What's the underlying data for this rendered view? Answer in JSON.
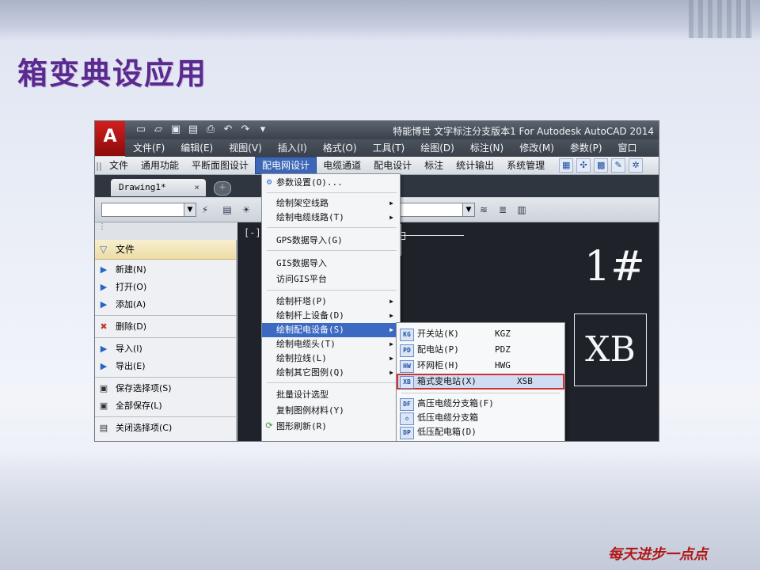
{
  "slide": {
    "title": "箱变典设应用",
    "brand_text": "每天进步一点点"
  },
  "cad": {
    "window_title": "特能博世 文字标注分支版本1 For Autodesk AutoCAD 2014",
    "menubar": [
      "文件(F)",
      "编辑(E)",
      "视图(V)",
      "插入(I)",
      "格式(O)",
      "工具(T)",
      "绘图(D)",
      "标注(N)",
      "修改(M)",
      "参数(P)",
      "窗口"
    ],
    "plugin_menubar": [
      "文件",
      "通用功能",
      "平断面图设计",
      "配电网设计",
      "电缆通道",
      "配电设计",
      "标注",
      "统计输出",
      "系统管理"
    ],
    "plugin_active_index": 3,
    "tab": {
      "label": "Drawing1*",
      "close": "×"
    },
    "left_panel": {
      "header": "文件",
      "items": [
        {
          "label": "新建(N)",
          "icon": "triangle-right-icon"
        },
        {
          "label": "打开(O)",
          "icon": "triangle-right-icon"
        },
        {
          "label": "添加(A)",
          "icon": "triangle-right-icon"
        },
        {
          "label": "删除(D)",
          "icon": "delete-icon"
        },
        {
          "label": "导入(I)",
          "icon": "triangle-right-icon"
        },
        {
          "label": "导出(E)",
          "icon": "triangle-right-icon"
        },
        {
          "label": "保存选择项(S)",
          "icon": "save-icon"
        },
        {
          "label": "全部保存(L)",
          "icon": "save-icon"
        },
        {
          "label": "关闭选择项(C)",
          "icon": "close-doc-icon"
        }
      ]
    },
    "drawing": {
      "viewport_label": "[-][",
      "number_label": "1#",
      "xb_label": "XB"
    },
    "dropdown": {
      "items": [
        {
          "label": "参数设置(O)...",
          "arrow": ""
        },
        {
          "label": "绘制架空线路",
          "arrow": "▶"
        },
        {
          "label": "绘制电缆线路(T)",
          "arrow": "▶"
        },
        {
          "label": "GPS数据导入(G)",
          "arrow": ""
        },
        {
          "label": "GIS数据导入",
          "arrow": ""
        },
        {
          "label": "访问GIS平台",
          "arrow": ""
        },
        {
          "label": "绘制杆塔(P)",
          "arrow": "▶"
        },
        {
          "label": "绘制杆上设备(D)",
          "arrow": "▶"
        },
        {
          "label": "绘制配电设备(S)",
          "arrow": "▶"
        },
        {
          "label": "绘制电缆头(T)",
          "arrow": "▶"
        },
        {
          "label": "绘制拉线(L)",
          "arrow": "▶"
        },
        {
          "label": "绘制其它图例(Q)",
          "arrow": "▶"
        },
        {
          "label": "批量设计选型",
          "arrow": ""
        },
        {
          "label": "复制图例材料(Y)",
          "arrow": ""
        },
        {
          "label": "图形刷新(R)",
          "arrow": ""
        }
      ],
      "highlight_index": 8
    },
    "submenu": {
      "items": [
        {
          "badge": "KG",
          "label": "开关站(K)",
          "code": "KGZ"
        },
        {
          "badge": "PD",
          "label": "配电站(P)",
          "code": "PDZ"
        },
        {
          "badge": "HW",
          "label": "环网柜(H)",
          "code": "HWG"
        },
        {
          "badge": "XB",
          "label": "箱式变电站(X)",
          "code": "XSB"
        },
        {
          "badge": "DF",
          "label": "高压电缆分支箱(F)",
          "code": ""
        },
        {
          "badge": "◇",
          "label": "低压电缆分支箱",
          "code": ""
        },
        {
          "badge": "DP",
          "label": "低压配电箱(D)",
          "code": ""
        }
      ],
      "selected_index": 3
    }
  }
}
